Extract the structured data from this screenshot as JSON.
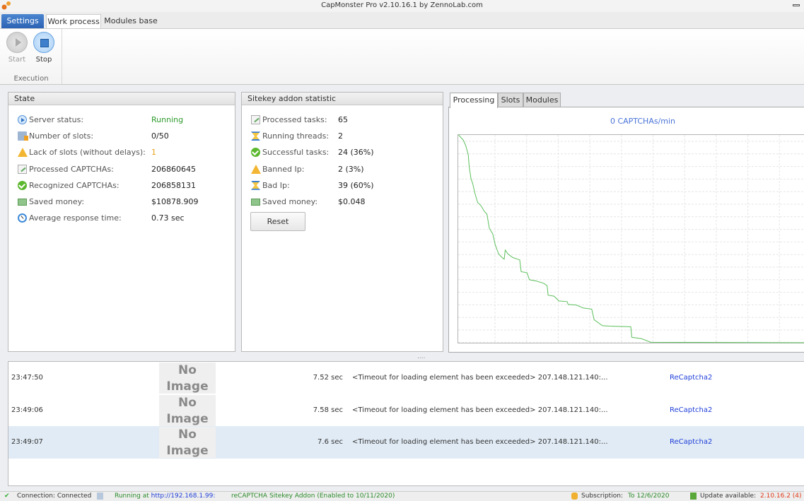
{
  "window": {
    "title": "CapMonster Pro v2.10.16.1 by ZennoLab.com"
  },
  "ribbon_tabs": [
    "Settings",
    "Work process",
    "Modules base"
  ],
  "ribbon": {
    "start_label": "Start",
    "stop_label": "Stop",
    "group_label": "Execution"
  },
  "state": {
    "title": "State",
    "rows": [
      {
        "icon": "play-icon",
        "label": "Server status:",
        "value": "Running",
        "color": "#2e9a2e"
      },
      {
        "icon": "slots-icon",
        "label": "Number of slots:",
        "value": "0/50"
      },
      {
        "icon": "warning-icon",
        "label": "Lack of slots (without delays):",
        "value": "1",
        "color": "#e8a21a"
      },
      {
        "icon": "edit-icon",
        "label": "Processed CAPTCHAs:",
        "value": "206860645"
      },
      {
        "icon": "check-icon",
        "label": "Recognized CAPTCHAs:",
        "value": "206858131"
      },
      {
        "icon": "money-icon",
        "label": "Saved money:",
        "value": "$10878.909"
      },
      {
        "icon": "clock-icon",
        "label": "Average response time:",
        "value": "0.73 sec"
      }
    ]
  },
  "sitekey": {
    "title": "Sitekey addon statistic",
    "rows": [
      {
        "icon": "edit-icon",
        "label": "Processed tasks:",
        "value": "65"
      },
      {
        "icon": "hourglass-icon",
        "label": "Running threads:",
        "value": "2"
      },
      {
        "icon": "check-icon",
        "label": "Successful tasks:",
        "value": "24 (36%)"
      },
      {
        "icon": "warning-icon",
        "label": "Banned Ip:",
        "value": "2 (3%)"
      },
      {
        "icon": "hourglass-icon",
        "label": "Bad Ip:",
        "value": "39 (60%)"
      },
      {
        "icon": "money-icon",
        "label": "Saved money:",
        "value": "$0.048"
      }
    ],
    "reset_label": "Reset"
  },
  "chart_tabs": [
    "Processing",
    "Slots",
    "Modules"
  ],
  "chart_data": {
    "type": "line",
    "title": "0 CAPTCHAs/min",
    "xlabel": "",
    "ylabel": "",
    "xlim": [
      0,
      100
    ],
    "ylim": [
      0,
      100
    ],
    "grid": true,
    "series": [
      {
        "name": "CAPTCHAs/min",
        "color": "#5cbf5c",
        "x": [
          0.1,
          1.5,
          2.2,
          2.9,
          3.2,
          3.7,
          4.2,
          4.8,
          5.6,
          6.6,
          7.6,
          8.3,
          9.0,
          10.0,
          10.7,
          11.7,
          12.7,
          13.3,
          13.6,
          14.4,
          15.8,
          17.2,
          17.8,
          18.2,
          19.9,
          20.6,
          22.6,
          24.7,
          25.7,
          26.0,
          27.7,
          29.1,
          31.5,
          31.8,
          34.2,
          36.2,
          38.6,
          39.3,
          41.7,
          43.7,
          49.9,
          50.2,
          52.9,
          55.7,
          100
        ],
        "y": [
          100,
          97.5,
          94.7,
          90.5,
          84.5,
          78.9,
          76.6,
          72.1,
          67.6,
          65.9,
          63.1,
          61.9,
          55.1,
          52.3,
          47.2,
          42.7,
          41.0,
          40.2,
          44.6,
          42.7,
          41.0,
          40.2,
          39.9,
          34.2,
          33.7,
          30.3,
          29.7,
          28.6,
          27.5,
          22.9,
          22.4,
          20.1,
          19.8,
          18.4,
          18.1,
          16.7,
          16.2,
          11.1,
          8.2,
          8.0,
          7.7,
          2.6,
          2.0,
          0.2,
          0
        ]
      }
    ]
  },
  "splitter": "....",
  "log": {
    "no_image": [
      "No",
      "Image"
    ],
    "rows": [
      {
        "time": "23:47:50",
        "duration": "7.52 sec",
        "message": "<Timeout for loading element has been exceeded>  207.148.121.140:...",
        "type": "ReCaptcha2"
      },
      {
        "time": "23:49:06",
        "duration": "7.58 sec",
        "message": "<Timeout for loading element has been exceeded>  207.148.121.140:...",
        "type": "ReCaptcha2"
      },
      {
        "time": "23:49:07",
        "duration": "7.6 sec",
        "message": "<Timeout for loading element has been exceeded>  207.148.121.140:...",
        "type": "ReCaptcha2",
        "selected": true
      }
    ]
  },
  "status": {
    "connection": "Connection: Connected",
    "running_prefix": "Running at",
    "running_url": "http://192.168.1.99:",
    "addon": "reCAPTCHA Sitekey Addon (Enabled to 10/11/2020)",
    "subscription_label": "Subscription:",
    "subscription_value": "To 12/6/2020",
    "update_label": "Update available:",
    "update_value": "2.10.16.2 (4)"
  }
}
